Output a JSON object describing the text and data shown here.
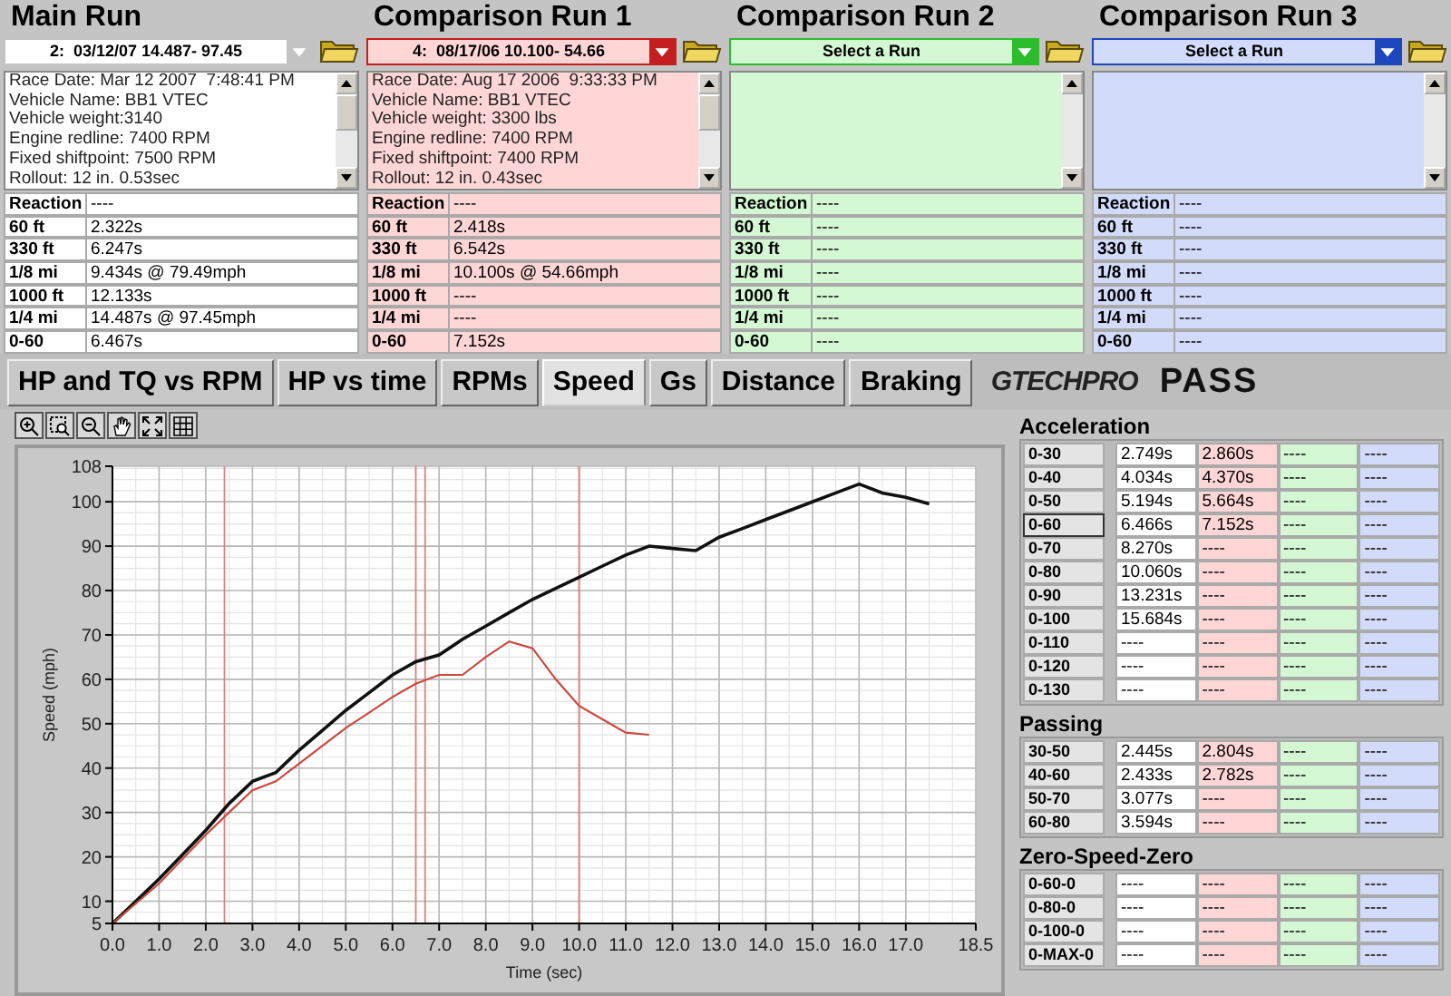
{
  "runs": [
    {
      "title": "Main Run",
      "color": "#ffffff",
      "dropdown": "2:  03/12/07 14.487- 97.45",
      "info": [
        "Race Date: Mar 12 2007  7:48:41 PM",
        "Vehicle Name: BB1 VTEC",
        "Vehicle weight:3140",
        "Engine redline: 7400 RPM",
        "Fixed shiftpoint: 7500 RPM",
        "Rollout: 12 in. 0.53sec"
      ],
      "stats": [
        [
          "Reaction",
          "----"
        ],
        [
          "60 ft",
          "2.322s"
        ],
        [
          "330 ft",
          "6.247s"
        ],
        [
          "1/8 mi",
          "9.434s @ 79.49mph"
        ],
        [
          "1000 ft",
          "12.133s"
        ],
        [
          "1/4 mi",
          "14.487s @ 97.45mph"
        ],
        [
          "0-60",
          "6.467s"
        ]
      ]
    },
    {
      "title": "Comparison Run 1",
      "color": "#ffd6d6",
      "dropdown": "4:  08/17/06 10.100- 54.66",
      "info": [
        "Race Date: Aug 17 2006  9:33:33 PM",
        "Vehicle Name: BB1 VTEC",
        "Vehicle weight: 3300 lbs",
        "Engine redline: 7400 RPM",
        "Fixed shiftpoint: 7400 RPM",
        "Rollout: 12 in. 0.43sec"
      ],
      "stats": [
        [
          "Reaction",
          "----"
        ],
        [
          "60 ft",
          "2.418s"
        ],
        [
          "330 ft",
          "6.542s"
        ],
        [
          "1/8 mi",
          "10.100s @ 54.66mph"
        ],
        [
          "1000 ft",
          "----"
        ],
        [
          "1/4 mi",
          "----"
        ],
        [
          "0-60",
          "7.152s"
        ]
      ]
    },
    {
      "title": "Comparison Run 2",
      "color": "#d4f8d4",
      "dropdown": "Select a Run",
      "stats": [
        [
          "Reaction",
          "----"
        ],
        [
          "60 ft",
          "----"
        ],
        [
          "330 ft",
          "----"
        ],
        [
          "1/8 mi",
          "----"
        ],
        [
          "1000 ft",
          "----"
        ],
        [
          "1/4 mi",
          "----"
        ],
        [
          "0-60",
          "----"
        ]
      ]
    },
    {
      "title": "Comparison Run 3",
      "color": "#d2dcfa",
      "dropdown": "Select a Run",
      "stats": [
        [
          "Reaction",
          "----"
        ],
        [
          "60 ft",
          "----"
        ],
        [
          "330 ft",
          "----"
        ],
        [
          "1/8 mi",
          "----"
        ],
        [
          "1000 ft",
          "----"
        ],
        [
          "1/4 mi",
          "----"
        ],
        [
          "0-60",
          "----"
        ]
      ]
    }
  ],
  "tabs": [
    {
      "label": "HP and TQ vs RPM",
      "selected": false
    },
    {
      "label": "HP vs time",
      "selected": false
    },
    {
      "label": "RPMs",
      "selected": false
    },
    {
      "label": "Speed",
      "selected": true
    },
    {
      "label": "Gs",
      "selected": false
    },
    {
      "label": "Distance",
      "selected": false
    },
    {
      "label": "Braking",
      "selected": false
    }
  ],
  "logo": "GTECHPRO",
  "product": "PASS",
  "chart": {
    "chart_data": {
      "type": "line",
      "xlabel": "Time (sec)",
      "ylabel": "Speed (mph)",
      "x": [
        0,
        0.5,
        1,
        1.5,
        2,
        2.5,
        3,
        3.5,
        4,
        4.5,
        5,
        5.5,
        6,
        6.5,
        7,
        7.5,
        8,
        8.5,
        9,
        9.5,
        10,
        10.5,
        11,
        11.5,
        12,
        12.5,
        13,
        13.5,
        14,
        14.5,
        15,
        15.5,
        16,
        16.5,
        17,
        17.5
      ],
      "series": [
        {
          "color": "#111111",
          "values": [
            5,
            10,
            15,
            20.5,
            26,
            32,
            37,
            39,
            44,
            48.5,
            53,
            57,
            61,
            64,
            65.5,
            69,
            72,
            75,
            78,
            80.5,
            83,
            85.5,
            88,
            90,
            89.5,
            89,
            92,
            94,
            96,
            98,
            100,
            102,
            104,
            102,
            101,
            99.5
          ]
        },
        {
          "color": "#c84a3c",
          "values": [
            5,
            9.5,
            14,
            19.5,
            25,
            30,
            35,
            37,
            41,
            45,
            49,
            52.5,
            56,
            59,
            61,
            61,
            65,
            68.5,
            67,
            60,
            54,
            51,
            48,
            47.5,
            null,
            null,
            null,
            null,
            null,
            null,
            null,
            null,
            null,
            null,
            null,
            null
          ]
        }
      ],
      "xlim": [
        0,
        18.5
      ],
      "ylim": [
        5,
        108
      ],
      "xticks": [
        {
          "value": 0,
          "label": "0.0"
        },
        {
          "value": 1,
          "label": "1.0"
        },
        {
          "value": 2,
          "label": "2.0"
        },
        {
          "value": 3,
          "label": "3.0"
        },
        {
          "value": 4,
          "label": "4.0"
        },
        {
          "value": 5,
          "label": "5.0"
        },
        {
          "value": 6,
          "label": "6.0"
        },
        {
          "value": 7,
          "label": "7.0"
        },
        {
          "value": 8,
          "label": "8.0"
        },
        {
          "value": 9,
          "label": "9.0"
        },
        {
          "value": 10,
          "label": "10.0"
        },
        {
          "value": 11,
          "label": "11.0"
        },
        {
          "value": 12,
          "label": "12.0"
        },
        {
          "value": 13,
          "label": "13.0"
        },
        {
          "value": 14,
          "label": "14.0"
        },
        {
          "value": 15,
          "label": "15.0"
        },
        {
          "value": 16,
          "label": "16.0"
        },
        {
          "value": 17,
          "label": "17.0"
        },
        {
          "value": 18.5,
          "label": "18.5"
        }
      ],
      "yticks": [
        5,
        10,
        20,
        30,
        40,
        50,
        60,
        70,
        80,
        90,
        100,
        108
      ],
      "grid": true,
      "ref_lines": [
        {
          "axis": "x",
          "value": 2.4
        },
        {
          "axis": "x",
          "value": 6.5
        },
        {
          "axis": "x",
          "value": 6.7
        },
        {
          "axis": "x",
          "value": 10.0
        }
      ]
    }
  },
  "results": [
    {
      "title": "Acceleration",
      "rows": [
        {
          "label": "0-30",
          "selected": false,
          "values": [
            "2.749s",
            "2.860s",
            "----",
            "----"
          ]
        },
        {
          "label": "0-40",
          "selected": false,
          "values": [
            "4.034s",
            "4.370s",
            "----",
            "----"
          ]
        },
        {
          "label": "0-50",
          "selected": false,
          "values": [
            "5.194s",
            "5.664s",
            "----",
            "----"
          ]
        },
        {
          "label": "0-60",
          "selected": true,
          "values": [
            "6.466s",
            "7.152s",
            "----",
            "----"
          ]
        },
        {
          "label": "0-70",
          "selected": false,
          "values": [
            "8.270s",
            "----",
            "----",
            "----"
          ]
        },
        {
          "label": "0-80",
          "selected": false,
          "values": [
            "10.060s",
            "----",
            "----",
            "----"
          ]
        },
        {
          "label": "0-90",
          "selected": false,
          "values": [
            "13.231s",
            "----",
            "----",
            "----"
          ]
        },
        {
          "label": "0-100",
          "selected": false,
          "values": [
            "15.684s",
            "----",
            "----",
            "----"
          ]
        },
        {
          "label": "0-110",
          "selected": false,
          "values": [
            "----",
            "----",
            "----",
            "----"
          ]
        },
        {
          "label": "0-120",
          "selected": false,
          "values": [
            "----",
            "----",
            "----",
            "----"
          ]
        },
        {
          "label": "0-130",
          "selected": false,
          "values": [
            "----",
            "----",
            "----",
            "----"
          ]
        }
      ]
    },
    {
      "title": "Passing",
      "rows": [
        {
          "label": "30-50",
          "selected": false,
          "values": [
            "2.445s",
            "2.804s",
            "----",
            "----"
          ]
        },
        {
          "label": "40-60",
          "selected": false,
          "values": [
            "2.433s",
            "2.782s",
            "----",
            "----"
          ]
        },
        {
          "label": "50-70",
          "selected": false,
          "values": [
            "3.077s",
            "----",
            "----",
            "----"
          ]
        },
        {
          "label": "60-80",
          "selected": false,
          "values": [
            "3.594s",
            "----",
            "----",
            "----"
          ]
        }
      ]
    },
    {
      "title": "Zero-Speed-Zero",
      "rows": [
        {
          "label": "0-60-0",
          "selected": false,
          "values": [
            "----",
            "----",
            "----",
            "----"
          ]
        },
        {
          "label": "0-80-0",
          "selected": false,
          "values": [
            "----",
            "----",
            "----",
            "----"
          ]
        },
        {
          "label": "0-100-0",
          "selected": false,
          "values": [
            "----",
            "----",
            "----",
            "----"
          ]
        },
        {
          "label": "0-MAX-0",
          "selected": false,
          "values": [
            "----",
            "----",
            "----",
            "----"
          ]
        }
      ]
    }
  ]
}
